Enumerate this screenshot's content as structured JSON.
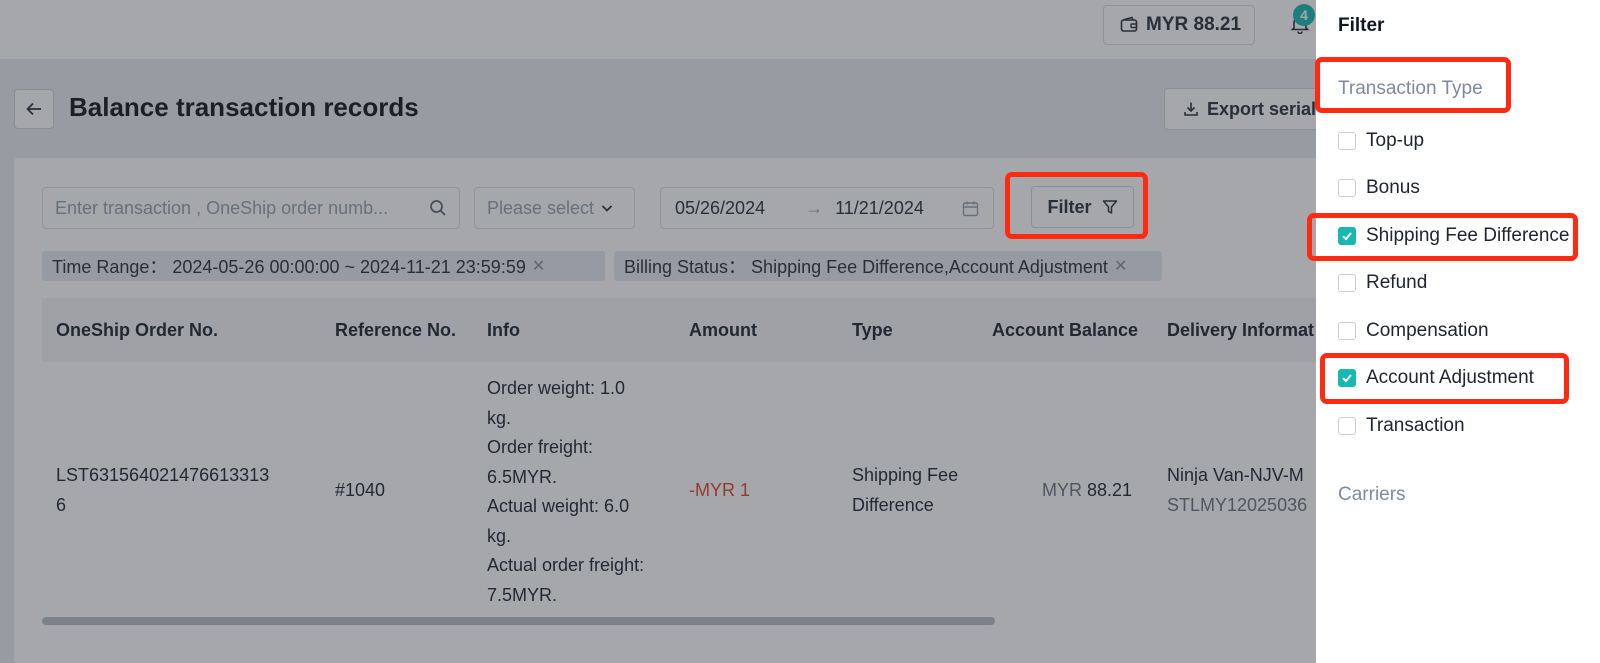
{
  "header": {
    "balance": "MYR 88.21",
    "notification_count": "4"
  },
  "page": {
    "title": "Balance transaction records",
    "export_label": "Export serial"
  },
  "filters": {
    "search_placeholder": "Enter transaction , OneShip order numb...",
    "select_placeholder": "Please select",
    "date_start": "05/26/2024",
    "date_end": "11/21/2024",
    "filter_label": "Filter"
  },
  "tags": {
    "time_range": "Time Range： 2024-05-26 00:00:00 ~ 2024-11-21 23:59:59",
    "billing_status": "Billing Status： Shipping Fee Difference,Account Adjustment"
  },
  "table": {
    "columns": [
      "OneShip Order No.",
      "Reference No.",
      "Info",
      "Amount",
      "Type",
      "Account Balance",
      "Delivery Informat"
    ],
    "rows": [
      {
        "order_no_1": "LST631564021476613313",
        "order_no_2": "6",
        "reference": "#1040",
        "info": [
          "Order weight: 1.0",
          "kg.",
          "Order freight:",
          "6.5MYR.",
          "Actual weight: 6.0",
          "kg.",
          "Actual order freight:",
          "7.5MYR."
        ],
        "amount": "-MYR 1",
        "type_1": "Shipping Fee",
        "type_2": "Difference",
        "balance_currency": "MYR",
        "balance_value": "88.21",
        "delivery_carrier": "Ninja Van-NJV-M",
        "delivery_tracking": "STLMY12025036"
      }
    ]
  },
  "drawer": {
    "title": "Filter",
    "transaction_type_label": "Transaction Type",
    "options": [
      {
        "label": "Top-up",
        "checked": false
      },
      {
        "label": "Bonus",
        "checked": false
      },
      {
        "label": "Shipping Fee Difference",
        "checked": true
      },
      {
        "label": "Refund",
        "checked": false
      },
      {
        "label": "Compensation",
        "checked": false
      },
      {
        "label": "Account Adjustment",
        "checked": true
      },
      {
        "label": "Transaction",
        "checked": false
      }
    ],
    "carriers_label": "Carriers"
  },
  "colors": {
    "accent": "#17b8b0",
    "negative": "#e0452c",
    "highlight": "#ff2a12"
  }
}
